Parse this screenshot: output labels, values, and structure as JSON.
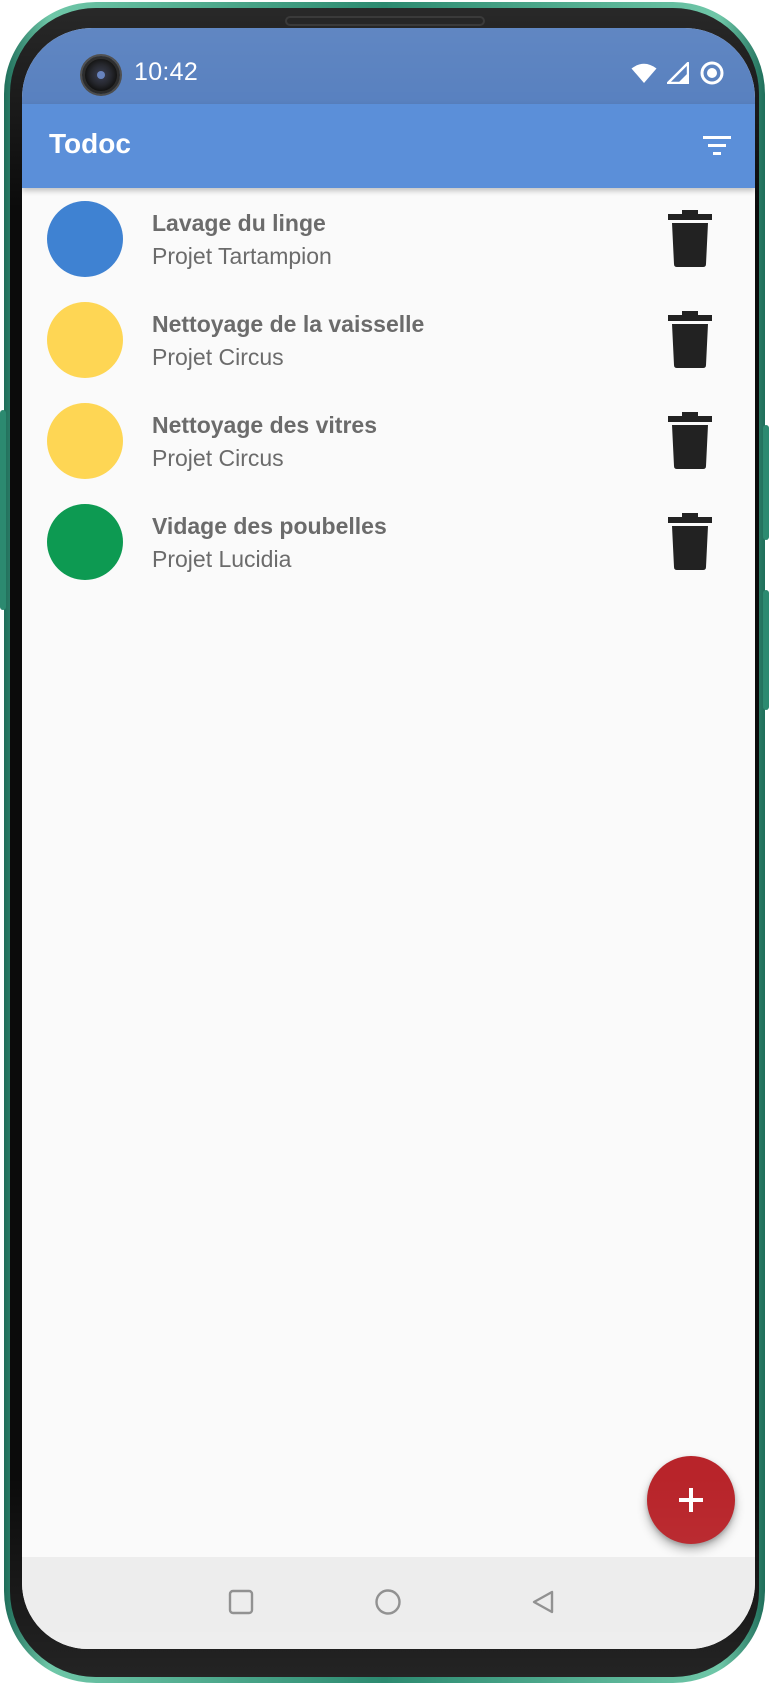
{
  "status_bar": {
    "time": "10:42",
    "icons": [
      "wifi-icon",
      "cellular-signal-icon",
      "data-saver-icon"
    ]
  },
  "app_bar": {
    "title": "Todoc",
    "filter_icon": "filter-icon"
  },
  "tasks": [
    {
      "name": "Lavage du linge",
      "project": "Projet Tartampion",
      "color": "#3f82d2"
    },
    {
      "name": "Nettoyage de la vaisselle",
      "project": "Projet Circus",
      "color": "#fed654"
    },
    {
      "name": "Nettoyage des vitres",
      "project": "Projet Circus",
      "color": "#fed654"
    },
    {
      "name": "Vidage des poubelles",
      "project": "Projet Lucidia",
      "color": "#0d9a52"
    }
  ],
  "fab": {
    "icon": "add-icon",
    "color": "#b8242a"
  },
  "nav_bar": {
    "buttons": [
      "recents-square-icon",
      "home-circle-icon",
      "back-triangle-icon"
    ]
  },
  "colors": {
    "status_bar": "#4d78bb",
    "app_bar": "#5b8fd9",
    "background": "#fafafa",
    "text": "#6b6b6b",
    "delete_icon": "#222222"
  }
}
